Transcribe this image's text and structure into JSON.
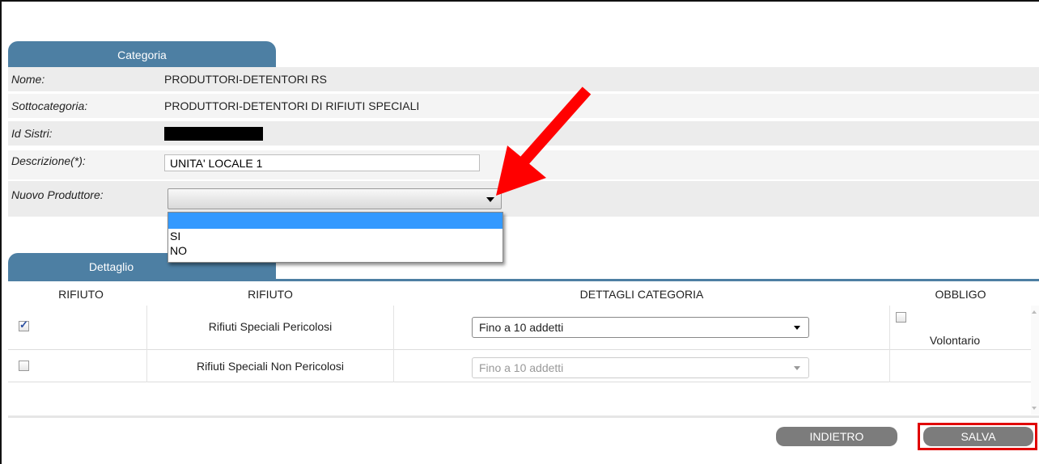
{
  "categoria_tab": "Categoria",
  "dettaglio_tab": "Dettaglio",
  "fields": {
    "nome_label": "Nome:",
    "nome_value": "PRODUTTORI-DETENTORI RS",
    "sottocategoria_label": "Sottocategoria:",
    "sottocategoria_value": "PRODUTTORI-DETENTORI DI RIFIUTI SPECIALI",
    "id_sistri_label": "Id Sistri:",
    "descrizione_label": "Descrizione(*):",
    "descrizione_value": "UNITA' LOCALE 1",
    "nuovo_produttore_label": "Nuovo Produttore:",
    "nuovo_produttore_value": ""
  },
  "dropdown_options": [
    "",
    "SI",
    "NO"
  ],
  "table": {
    "headers": [
      "RIFIUTO",
      "RIFIUTO",
      "DETTAGLI CATEGORIA",
      "OBBLIGO"
    ],
    "rows": [
      {
        "checked": true,
        "rifiuto": "Rifiuti Speciali Pericolosi",
        "dettagli": "Fino a 10 addetti",
        "enabled": true,
        "obbligo_checked": false,
        "obbligo_label": "Volontario"
      },
      {
        "checked": false,
        "rifiuto": "Rifiuti Speciali Non Pericolosi",
        "dettagli": "Fino a 10 addetti",
        "enabled": false,
        "obbligo_checked": false,
        "obbligo_label": ""
      }
    ]
  },
  "buttons": {
    "indietro": "INDIETRO",
    "salva": "SALVA"
  },
  "colors": {
    "tab_blue": "#4d7fa3",
    "highlight_red": "#e00000",
    "selected_option": "#3399ff",
    "button_grey": "#7c7c7c"
  },
  "icons": [
    "dropdown-caret-icon",
    "red-arrow-icon",
    "checkbox-icon"
  ]
}
